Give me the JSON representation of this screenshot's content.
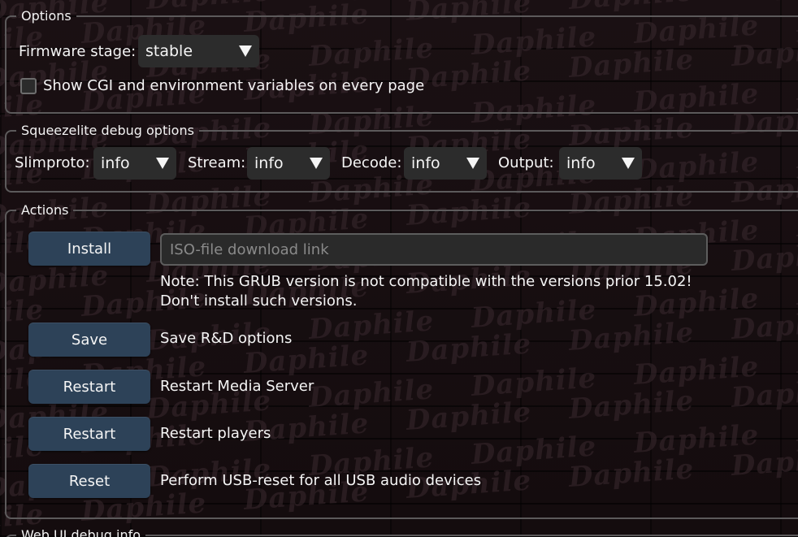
{
  "watermark": {
    "text": "Daphile"
  },
  "options": {
    "legend": "Options",
    "firmware_label": "Firmware stage:",
    "firmware_value": "stable",
    "cgi_checkbox_label": "Show CGI and environment variables on every page",
    "cgi_checked": false
  },
  "squeezelite": {
    "legend": "Squeezelite debug options",
    "slimproto_label": "Slimproto:",
    "slimproto_value": "info",
    "stream_label": "Stream:",
    "stream_value": "info",
    "decode_label": "Decode:",
    "decode_value": "info",
    "output_label": "Output:",
    "output_value": "info"
  },
  "actions": {
    "legend": "Actions",
    "install_button": "Install",
    "iso_placeholder": "ISO-file download link",
    "iso_value": "",
    "note_line1": "Note: This GRUB version is not compatible with the versions prior 15.02!",
    "note_line2": "Don't install such versions.",
    "save_button": "Save",
    "save_desc": "Save R&D options",
    "restart_server_button": "Restart",
    "restart_server_desc": "Restart Media Server",
    "restart_players_button": "Restart",
    "restart_players_desc": "Restart players",
    "reset_button": "Reset",
    "reset_desc": "Perform USB-reset for all USB audio devices"
  },
  "webui": {
    "legend": "Web UI debug info"
  },
  "colors": {
    "background": "#150d0f",
    "button": "#2d4258",
    "control": "#2c2c2c",
    "border": "#5c5a5b",
    "text": "#f5f5f5"
  }
}
